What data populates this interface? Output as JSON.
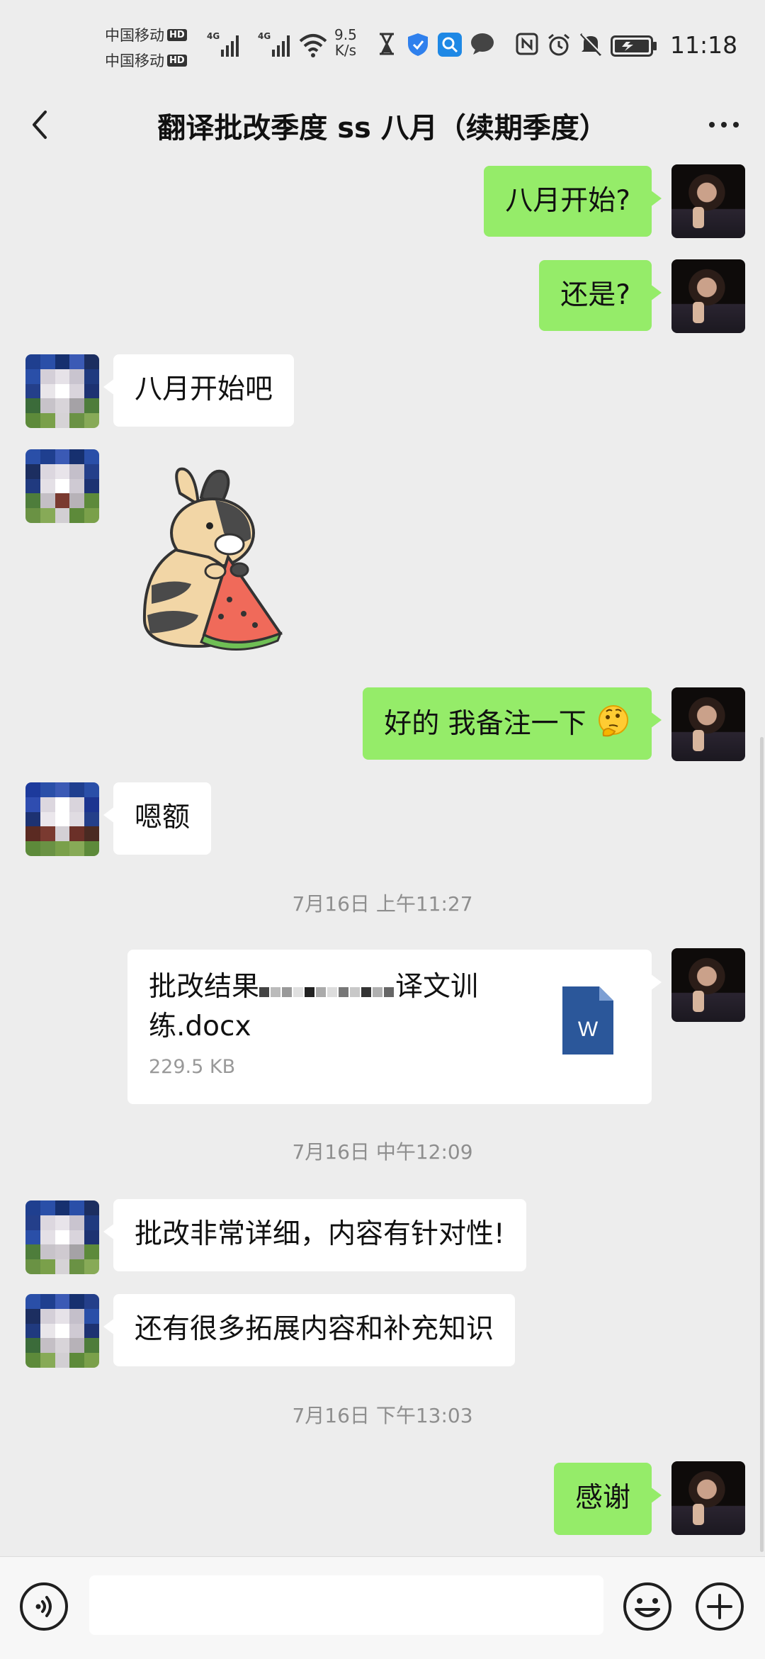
{
  "status_bar": {
    "carrier_1": "中国移动",
    "carrier_2": "中国移动",
    "hd_badge": "HD",
    "network_type": "4G",
    "net_speed_value": "9.5",
    "net_speed_unit": "K/s",
    "time": "11:18",
    "icons": [
      "hourglass-icon",
      "shield-icon",
      "search-app-icon",
      "chat-bubble-icon",
      "nfc-icon",
      "alarm-icon",
      "mute-icon",
      "battery-icon"
    ]
  },
  "nav": {
    "title": "翻译批改季度 ss 八月（续期季度）",
    "back_icon": "chevron-left-icon",
    "more_icon": "more-dots-icon"
  },
  "messages": [
    {
      "sender": "me",
      "type": "text",
      "text": "八月开始?"
    },
    {
      "sender": "me",
      "type": "text",
      "text": "还是?"
    },
    {
      "sender": "other",
      "type": "text",
      "text": "八月开始吧"
    },
    {
      "sender": "other",
      "type": "sticker",
      "sticker": "bunny-eating-watermelon"
    },
    {
      "sender": "me",
      "type": "text",
      "text": "好的 我备注一下",
      "emoji": "thinking-face-emoji"
    },
    {
      "sender": "other",
      "type": "text",
      "text": "嗯额"
    },
    {
      "type": "timestamp",
      "text": "7月16日 上午11:27"
    },
    {
      "sender": "me",
      "type": "file",
      "file_name_start": "批改结果",
      "file_name_mid": "译文训",
      "file_name_line2": "练.docx",
      "file_size": "229.5 KB",
      "file_icon": "word-file-icon",
      "file_icon_letter": "W"
    },
    {
      "type": "timestamp",
      "text": "7月16日 中午12:09"
    },
    {
      "sender": "other",
      "type": "text",
      "text": "批改非常详细，内容有针对性!"
    },
    {
      "sender": "other",
      "type": "text",
      "text": "还有很多拓展内容和补充知识"
    },
    {
      "type": "timestamp",
      "text": "7月16日 下午13:03"
    },
    {
      "sender": "me",
      "type": "text",
      "text": "感谢"
    }
  ],
  "input_bar": {
    "voice_icon": "voice-icon",
    "emoji_icon": "smiley-icon",
    "plus_icon": "plus-circle-icon",
    "input_value": ""
  },
  "colors": {
    "background": "#ededed",
    "my_bubble": "#95ec69",
    "their_bubble": "#ffffff",
    "timestamp_text": "#8e8e8e",
    "word_blue": "#2b579a"
  }
}
